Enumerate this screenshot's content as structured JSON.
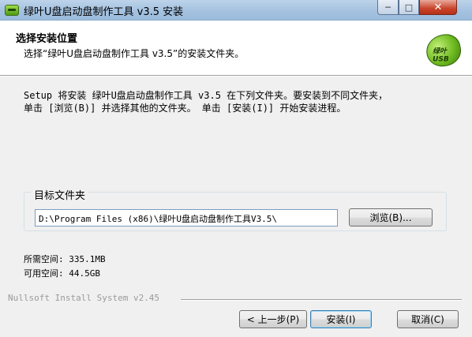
{
  "window": {
    "title": "绿叶U盘启动盘制作工具 v3.5 安装",
    "minimize": "─",
    "maximize": "□",
    "close": "✕"
  },
  "header": {
    "title": "选择安装位置",
    "subtitle": "选择“绿叶U盘启动盘制作工具 v3.5”的安装文件夹。",
    "logo_text": "绿叶USB"
  },
  "intro": "Setup 将安装 绿叶U盘启动盘制作工具 v3.5 在下列文件夹。要安装到不同文件夹，\n单击 [浏览(B)] 并选择其他的文件夹。 单击 [安装(I)] 开始安装进程。",
  "destination": {
    "group_label": "目标文件夹",
    "path": "D:\\Program Files (x86)\\绿叶U盘启动盘制作工具V3.5\\",
    "browse_label": "浏览(B)..."
  },
  "space": {
    "required": "所需空间: 335.1MB",
    "available": "可用空间: 44.5GB"
  },
  "branding": "Nullsoft Install System v2.45",
  "buttons": {
    "back": "< 上一步(P)",
    "install": "安装(I)",
    "cancel": "取消(C)"
  }
}
